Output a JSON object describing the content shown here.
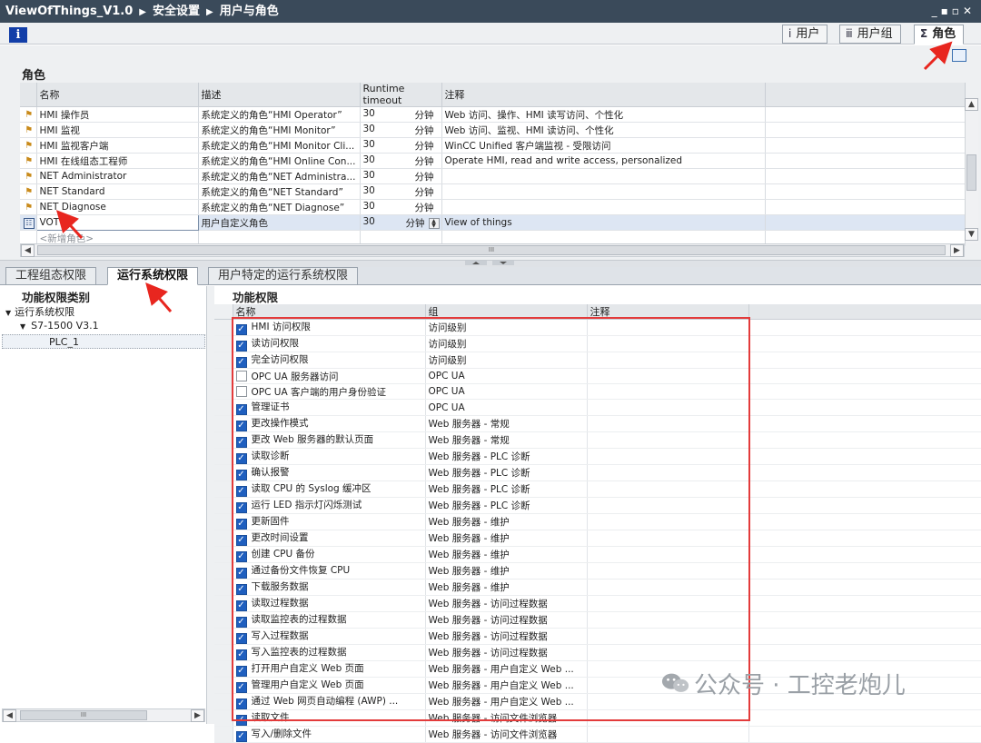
{
  "window": {
    "breadcrumb": [
      "ViewOfThings_V1.0",
      "安全设置",
      "用户与角色"
    ],
    "controls": "_▪▫✕"
  },
  "toolbar": {
    "info_glyph": "i",
    "tabs": [
      {
        "label": "用户",
        "icon": "user-icon"
      },
      {
        "label": "用户组",
        "icon": "user-group-icon"
      },
      {
        "label": "角色",
        "icon": "role-icon",
        "active": true
      }
    ]
  },
  "roles": {
    "section_title": "角色",
    "columns": [
      "名称",
      "描述",
      "Runtime timeout",
      "注释"
    ],
    "rows": [
      {
        "name": "HMI 操作员",
        "desc": "系统定义的角色“HMI Operator”",
        "timeout": "30",
        "unit": "分钟",
        "note": "Web 访问、操作、HMI 读写访问、个性化"
      },
      {
        "name": "HMI 监视",
        "desc": "系统定义的角色“HMI Monitor”",
        "timeout": "30",
        "unit": "分钟",
        "note": "Web 访问、监视、HMI 读访问、个性化"
      },
      {
        "name": "HMI 监视客户端",
        "desc": "系统定义的角色“HMI Monitor Cli...",
        "timeout": "30",
        "unit": "分钟",
        "note": "WinCC Unified 客户端监视 - 受限访问"
      },
      {
        "name": "HMI 在线组态工程师",
        "desc": "系统定义的角色“HMI Online Con...",
        "timeout": "30",
        "unit": "分钟",
        "note": "Operate HMI, read and write access, personalized"
      },
      {
        "name": "NET Administrator",
        "desc": "系统定义的角色“NET Administra...",
        "timeout": "30",
        "unit": "分钟",
        "note": ""
      },
      {
        "name": "NET Standard",
        "desc": "系统定义的角色“NET Standard”",
        "timeout": "30",
        "unit": "分钟",
        "note": ""
      },
      {
        "name": "NET Diagnose",
        "desc": "系统定义的角色“NET Diagnose”",
        "timeout": "30",
        "unit": "分钟",
        "note": ""
      },
      {
        "name": "VOT",
        "desc": "用户自定义角色",
        "timeout": "30",
        "unit": "分钟",
        "note": "View of things"
      }
    ],
    "add_placeholder": "<新增角色>",
    "hscroll_grip": "III"
  },
  "bottom_tabs": [
    {
      "label": "工程组态权限"
    },
    {
      "label": "运行系统权限",
      "active": true
    },
    {
      "label": "用户特定的运行系统权限"
    }
  ],
  "left_pane": {
    "title": "功能权限类别",
    "tree": [
      {
        "label": "运行系统权限",
        "level": 0,
        "expanded": true
      },
      {
        "label": "S7-1500 V3.1",
        "level": 1,
        "expanded": true
      },
      {
        "label": "PLC_1",
        "level": 2,
        "selected": true
      }
    ],
    "hscroll_grip": "III"
  },
  "permissions": {
    "title": "功能权限",
    "columns": [
      "名称",
      "组",
      "注释"
    ],
    "rows": [
      {
        "name": "HMI 访问权限",
        "group": "访问级别",
        "checked": true
      },
      {
        "name": "读访问权限",
        "group": "访问级别",
        "checked": true
      },
      {
        "name": "完全访问权限",
        "group": "访问级别",
        "checked": true
      },
      {
        "name": "OPC UA 服务器访问",
        "group": "OPC UA",
        "checked": false
      },
      {
        "name": "OPC UA 客户端的用户身份验证",
        "group": "OPC UA",
        "checked": false
      },
      {
        "name": "管理证书",
        "group": "OPC UA",
        "checked": true
      },
      {
        "name": "更改操作模式",
        "group": "Web 服务器 - 常规",
        "checked": true
      },
      {
        "name": "更改 Web 服务器的默认页面",
        "group": "Web 服务器 - 常规",
        "checked": true
      },
      {
        "name": "读取诊断",
        "group": "Web 服务器 - PLC 诊断",
        "checked": true
      },
      {
        "name": "确认报警",
        "group": "Web 服务器 - PLC 诊断",
        "checked": true
      },
      {
        "name": "读取 CPU 的 Syslog 缓冲区",
        "group": "Web 服务器 - PLC 诊断",
        "checked": true
      },
      {
        "name": "运行 LED 指示灯闪烁测试",
        "group": "Web 服务器 - PLC 诊断",
        "checked": true
      },
      {
        "name": "更新固件",
        "group": "Web 服务器 - 维护",
        "checked": true
      },
      {
        "name": "更改时间设置",
        "group": "Web 服务器 - 维护",
        "checked": true
      },
      {
        "name": "创建 CPU 备份",
        "group": "Web 服务器 - 维护",
        "checked": true
      },
      {
        "name": "通过备份文件恢复 CPU",
        "group": "Web 服务器 - 维护",
        "checked": true
      },
      {
        "name": "下载服务数据",
        "group": "Web 服务器 - 维护",
        "checked": true
      },
      {
        "name": "读取过程数据",
        "group": "Web 服务器 - 访问过程数据",
        "checked": true
      },
      {
        "name": "读取监控表的过程数据",
        "group": "Web 服务器 - 访问过程数据",
        "checked": true
      },
      {
        "name": "写入过程数据",
        "group": "Web 服务器 - 访问过程数据",
        "checked": true
      },
      {
        "name": "写入监控表的过程数据",
        "group": "Web 服务器 - 访问过程数据",
        "checked": true
      },
      {
        "name": "打开用户自定义 Web 页面",
        "group": "Web 服务器 - 用户自定义 Web ...",
        "checked": true
      },
      {
        "name": "管理用户自定义 Web 页面",
        "group": "Web 服务器 - 用户自定义 Web ...",
        "checked": true
      },
      {
        "name": "通过 Web 网页自动编程 (AWP) ...",
        "group": "Web 服务器 - 用户自定义 Web ...",
        "checked": true
      },
      {
        "name": "读取文件",
        "group": "Web 服务器 - 访问文件浏览器",
        "checked": true
      },
      {
        "name": "写入/删除文件",
        "group": "Web 服务器 - 访问文件浏览器",
        "checked": true
      }
    ]
  },
  "watermark": {
    "text": "公众号 · 工控老炮儿"
  },
  "colors": {
    "titlebar": "#3a4a5a",
    "highlight_box": "#e33b3b",
    "checkbox": "#1f5fbf",
    "arrow": "#e8261f"
  }
}
